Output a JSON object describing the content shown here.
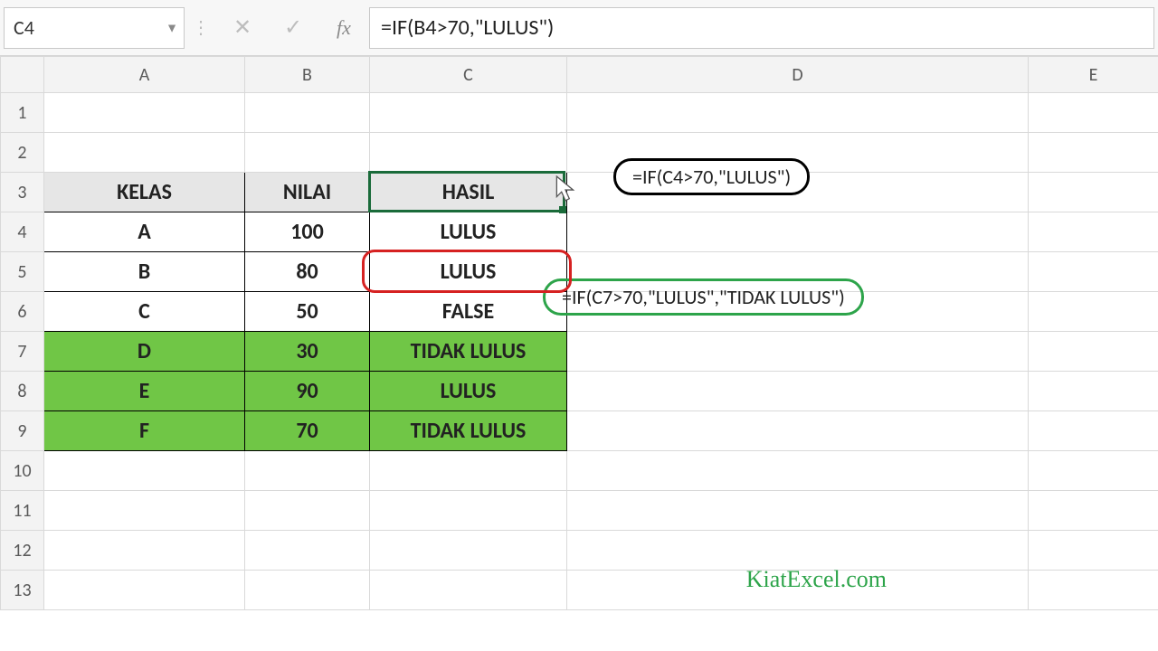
{
  "name_box": "C4",
  "formula_bar": "=IF(B4>70,\"LULUS\")",
  "columns": [
    "A",
    "B",
    "C",
    "D",
    "E"
  ],
  "row_numbers": [
    "1",
    "2",
    "3",
    "4",
    "5",
    "6",
    "7",
    "8",
    "9",
    "10",
    "11",
    "12",
    "13"
  ],
  "headers": {
    "kelas": "KELAS",
    "nilai": "NILAI",
    "hasil": "HASIL"
  },
  "rows": [
    {
      "kelas": "A",
      "nilai": "100",
      "hasil": "LULUS",
      "green": false
    },
    {
      "kelas": "B",
      "nilai": "80",
      "hasil": "LULUS",
      "green": false
    },
    {
      "kelas": "C",
      "nilai": "50",
      "hasil": "FALSE",
      "green": false
    },
    {
      "kelas": "D",
      "nilai": "30",
      "hasil": "TIDAK LULUS",
      "green": true
    },
    {
      "kelas": "E",
      "nilai": "90",
      "hasil": "LULUS",
      "green": true
    },
    {
      "kelas": "F",
      "nilai": "70",
      "hasil": "TIDAK LULUS",
      "green": true
    }
  ],
  "callouts": {
    "black": "=IF(C4>70,\"LULUS\")",
    "green": "=IF(C7>70,\"LULUS\",\"TIDAK LULUS\")"
  },
  "watermark": "KiatExcel.com",
  "icons": {
    "cancel": "✕",
    "enter": "✓",
    "fx": "fx",
    "dropdown": "▼",
    "dots": "⋮"
  }
}
